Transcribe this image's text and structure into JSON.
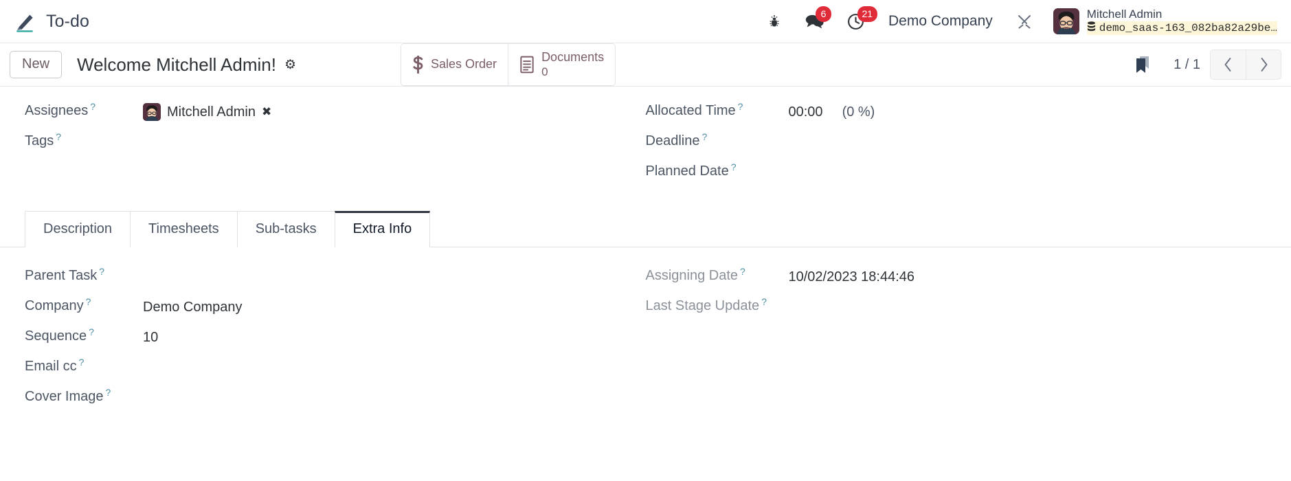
{
  "navbar": {
    "app_name": "To-do",
    "app_icon": "pencil-icon",
    "bug_icon": "bug-icon",
    "messages_icon": "messages-icon",
    "messages_badge": "6",
    "activities_icon": "clock-icon",
    "activities_badge": "21",
    "company": "Demo Company",
    "tools_icon": "wrench-screwdriver-icon",
    "user": {
      "name": "Mitchell Admin",
      "database_icon": "database-icon",
      "database": "demo_saas-163_082ba82a29be…"
    }
  },
  "control_panel": {
    "new_label": "New",
    "record_title": "Welcome Mitchell Admin!",
    "settings_icon": "gear-icon",
    "stat_buttons": [
      {
        "icon": "dollar-icon",
        "label": "Sales Order",
        "value": ""
      },
      {
        "icon": "document-icon",
        "label": "Documents",
        "value": "0"
      }
    ],
    "bookmark_icon": "bookmark-icon",
    "pager": "1 / 1",
    "prev_icon": "chevron-left-icon",
    "next_icon": "chevron-right-icon"
  },
  "form": {
    "left_fields": [
      {
        "label": "Assignees",
        "help": "?",
        "value": "",
        "tag": "Mitchell Admin",
        "remove_icon": "close-icon"
      },
      {
        "label": "Tags",
        "help": "?",
        "value": ""
      }
    ],
    "right_fields": [
      {
        "label": "Allocated Time",
        "help": "?",
        "value": "00:00",
        "suffix": "(0 %)"
      },
      {
        "label": "Deadline",
        "help": "?",
        "value": ""
      },
      {
        "label": "Planned Date",
        "help": "?",
        "value": ""
      }
    ]
  },
  "notebook": {
    "tabs": [
      {
        "label": "Description",
        "active": false
      },
      {
        "label": "Timesheets",
        "active": false
      },
      {
        "label": "Sub-tasks",
        "active": false
      },
      {
        "label": "Extra Info",
        "active": true
      }
    ],
    "extra_info": {
      "left_fields": [
        {
          "label": "Parent Task",
          "help": "?",
          "value": ""
        },
        {
          "label": "Company",
          "help": "?",
          "value": "Demo Company"
        },
        {
          "label": "Sequence",
          "help": "?",
          "value": "10"
        },
        {
          "label": "Email cc",
          "help": "?",
          "value": ""
        },
        {
          "label": "Cover Image",
          "help": "?",
          "value": ""
        }
      ],
      "right_fields": [
        {
          "label": "Assigning Date",
          "help": "?",
          "value": "10/02/2023 18:44:46",
          "muted": true
        },
        {
          "label": "Last Stage Update",
          "help": "?",
          "value": "",
          "muted": true
        }
      ]
    }
  },
  "colors": {
    "badge_red": "#e02b38",
    "accent_dark": "#2f3542",
    "stat_purple": "#7a5d68",
    "help_blue": "#4e8fa3",
    "db_highlight": "#fdf6d8"
  }
}
